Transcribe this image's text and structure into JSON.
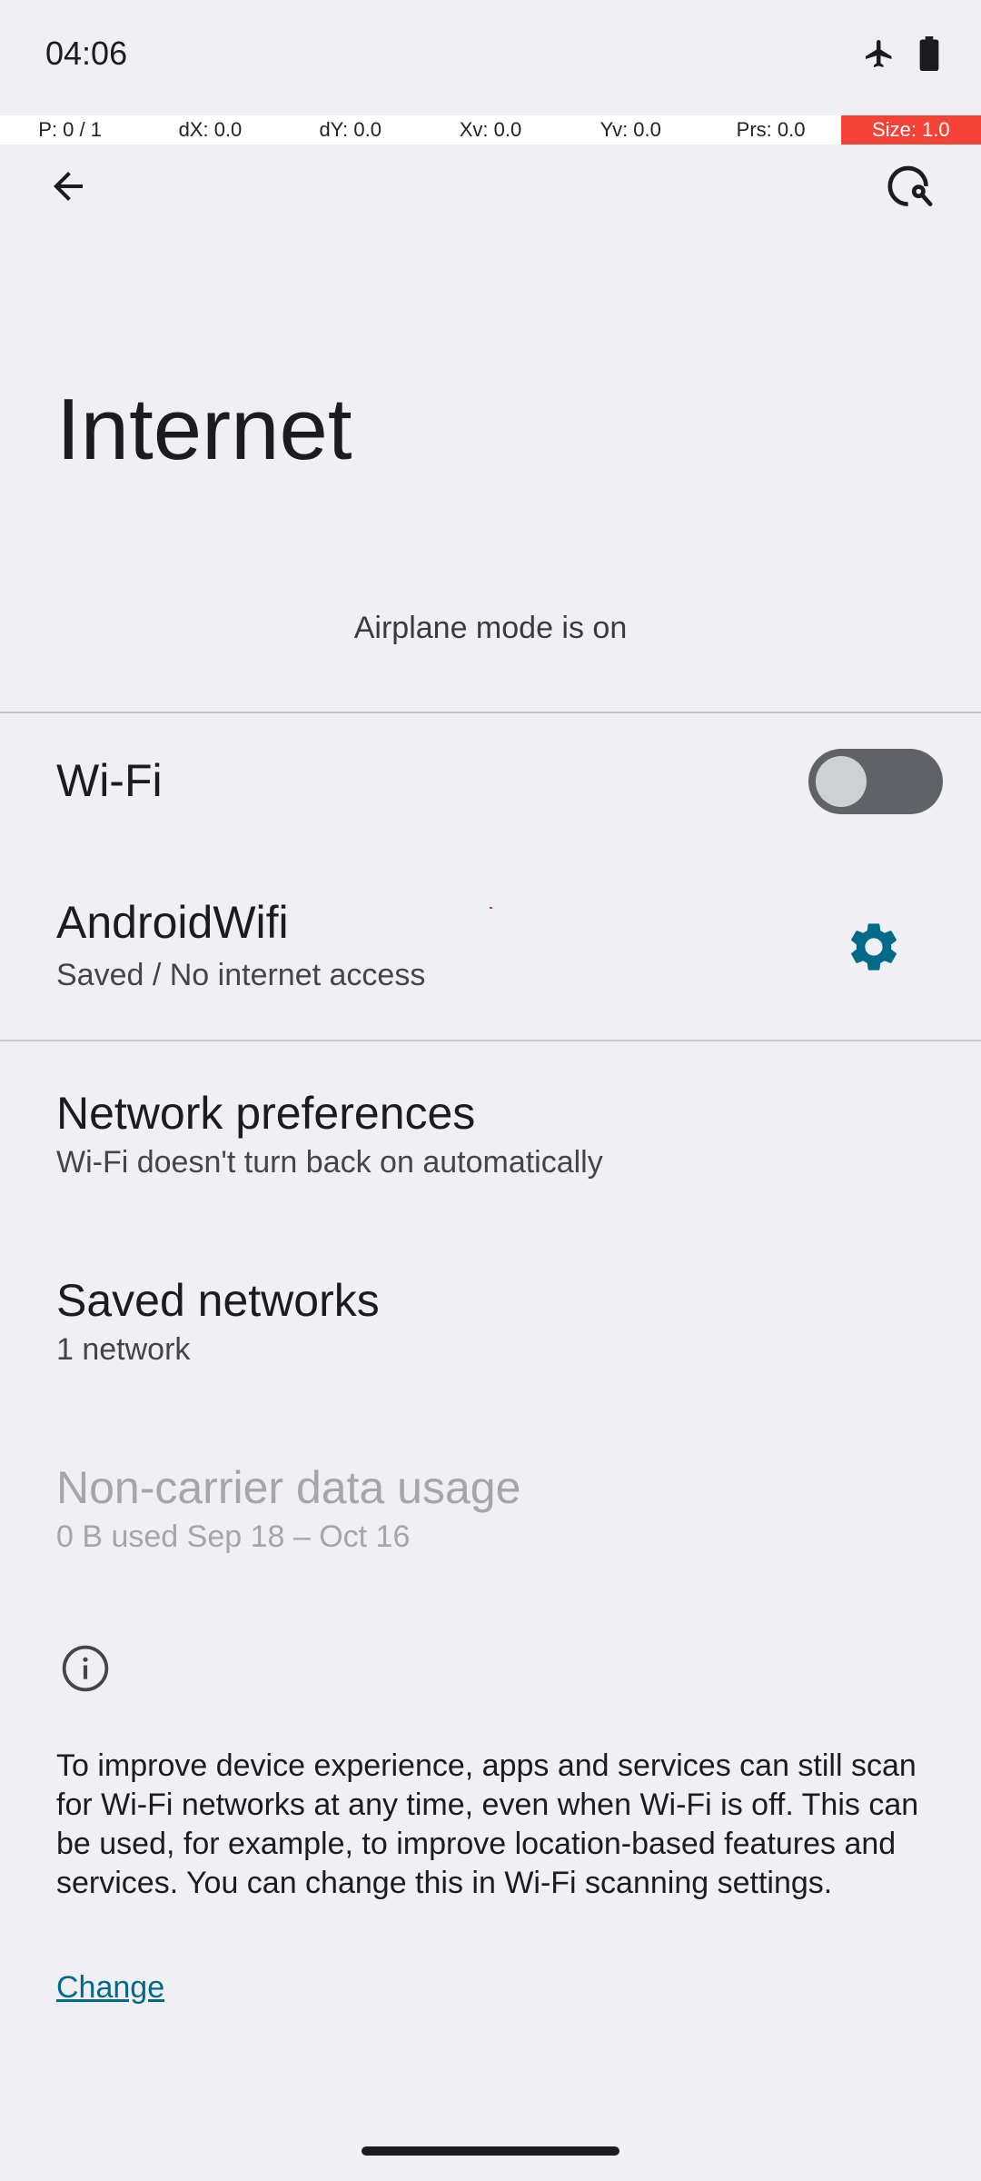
{
  "status_bar": {
    "time": "04:06",
    "icons": [
      "airplane-icon",
      "battery-icon"
    ]
  },
  "pointer_location": {
    "cells": [
      "P: 0 / 1",
      "dX: 0.0",
      "dY: 0.0",
      "Xv: 0.0",
      "Yv: 0.0",
      "Prs: 0.0",
      "Size: 1.0"
    ]
  },
  "toolbar": {
    "back_icon": "arrow-back-icon",
    "help_icon": "troubleshoot-icon"
  },
  "page": {
    "title": "Internet",
    "airplane_banner": "Airplane mode is on"
  },
  "wifi": {
    "label": "Wi-Fi",
    "enabled": false
  },
  "network": {
    "name": "AndroidWifi",
    "status": "Saved / No internet access",
    "settings_icon": "gear-icon"
  },
  "preferences": {
    "title": "Network preferences",
    "subtitle": "Wi-Fi doesn't turn back on automatically"
  },
  "saved_networks": {
    "title": "Saved networks",
    "subtitle": "1 network"
  },
  "data_usage": {
    "title": "Non-carrier data usage",
    "subtitle": "0 B used Sep 18 – Oct 16"
  },
  "info": {
    "icon": "info-icon",
    "text": "To improve device experience, apps and services can still scan for Wi-Fi networks at any time, even when Wi-Fi is off. This can be used, for example, to improve location-based features and services. You can change this in Wi-Fi scanning settings.",
    "link": "Change"
  },
  "colors": {
    "accent": "#006a89",
    "background": "#f0eff4",
    "toggle_off": "#5f6368"
  }
}
